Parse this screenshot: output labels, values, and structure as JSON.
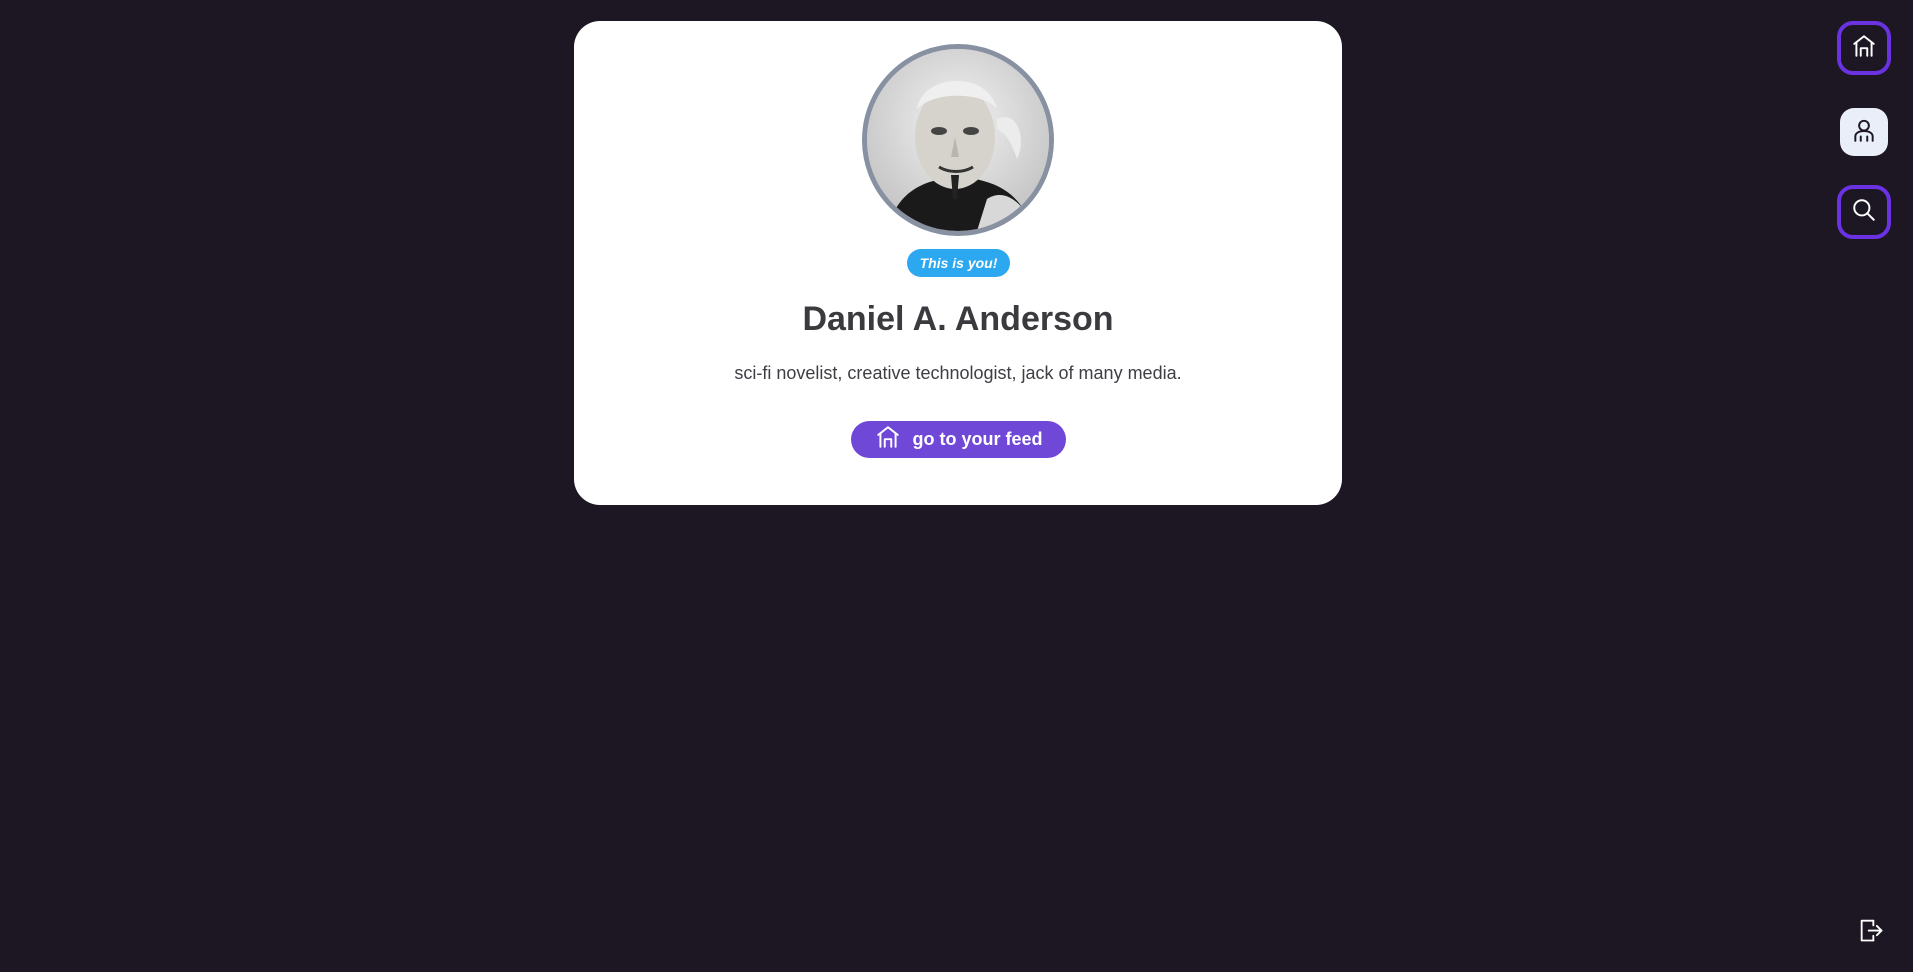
{
  "profile": {
    "badge": "This is you!",
    "name": "Daniel A. Anderson",
    "bio": "sci-fi novelist, creative technologist, jack of many media."
  },
  "actions": {
    "feed_button_label": "go to your feed"
  },
  "sidebar": {
    "items": [
      {
        "icon": "home-icon",
        "state": "outlined"
      },
      {
        "icon": "user-icon",
        "state": "active"
      },
      {
        "icon": "search-icon",
        "state": "outlined"
      }
    ],
    "footer_icon": "logout-icon"
  },
  "colors": {
    "background": "#1c1722",
    "card": "#ffffff",
    "accent": "#7048d8",
    "badge": "#2ba8f0",
    "outline": "#6a32e0"
  }
}
